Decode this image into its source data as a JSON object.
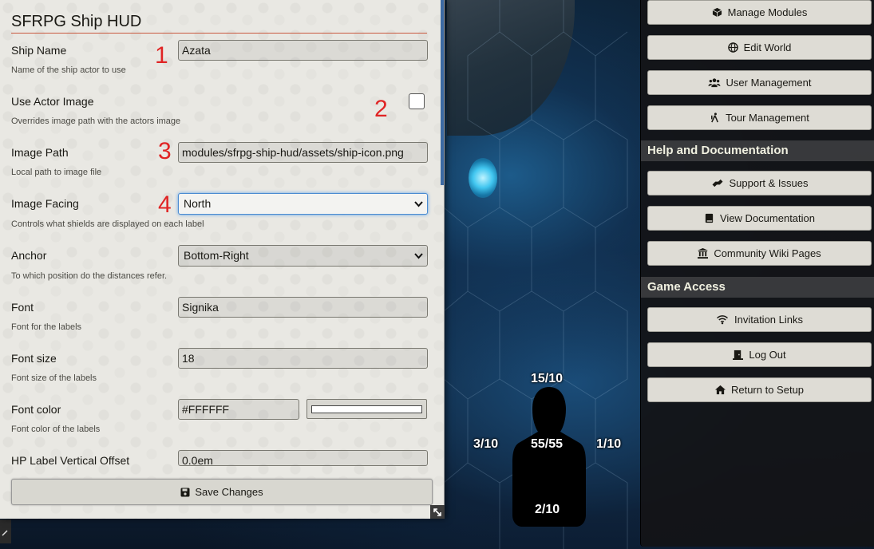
{
  "settings": {
    "title": "SFRPG Ship HUD",
    "fields": [
      {
        "label": "Ship Name",
        "hint": "Name of the ship actor to use",
        "value": "Azata",
        "annotation": "1"
      },
      {
        "label": "Use Actor Image",
        "hint": "Overrides image path with the actors image",
        "checked": false,
        "annotation": "2"
      },
      {
        "label": "Image Path",
        "hint": "Local path to image file",
        "value": "modules/sfrpg-ship-hud/assets/ship-icon.png",
        "annotation": "3"
      },
      {
        "label": "Image Facing",
        "hint": "Controls what shields are displayed on each label",
        "value": "North",
        "annotation": "4"
      },
      {
        "label": "Anchor",
        "hint": "To which position do the distances refer.",
        "value": "Bottom-Right"
      },
      {
        "label": "Font",
        "hint": "Font for the labels",
        "value": "Signika"
      },
      {
        "label": "Font size",
        "hint": "Font size of the labels",
        "value": "18"
      },
      {
        "label": "Font color",
        "hint": "Font color of the labels",
        "value": "#FFFFFF",
        "swatch_color": "#FFFFFF"
      },
      {
        "label": "HP Label Vertical Offset",
        "value": "0.0em"
      }
    ],
    "save_label": "Save Changes"
  },
  "token": {
    "top": "15/10",
    "left": "3/10",
    "center": "55/55",
    "right": "1/10",
    "bottom": "2/10"
  },
  "sidebar": {
    "top_buttons": [
      {
        "label": "Manage Modules",
        "icon": "cube-icon"
      },
      {
        "label": "Edit World",
        "icon": "globe-icon"
      },
      {
        "label": "User Management",
        "icon": "users-icon"
      },
      {
        "label": "Tour Management",
        "icon": "hiking-icon"
      }
    ],
    "help_header": "Help and Documentation",
    "help_buttons": [
      {
        "label": "Support & Issues",
        "icon": "hands-helping-icon"
      },
      {
        "label": "View Documentation",
        "icon": "book-icon"
      },
      {
        "label": "Community Wiki Pages",
        "icon": "landmark-icon"
      }
    ],
    "access_header": "Game Access",
    "access_buttons": [
      {
        "label": "Invitation Links",
        "icon": "wifi-icon"
      },
      {
        "label": "Log Out",
        "icon": "door-open-icon"
      },
      {
        "label": "Return to Setup",
        "icon": "home-icon"
      }
    ]
  },
  "colors": {
    "accent_rule": "#c9593f",
    "annotation": "#e02424",
    "focus": "#4a8bd1"
  }
}
